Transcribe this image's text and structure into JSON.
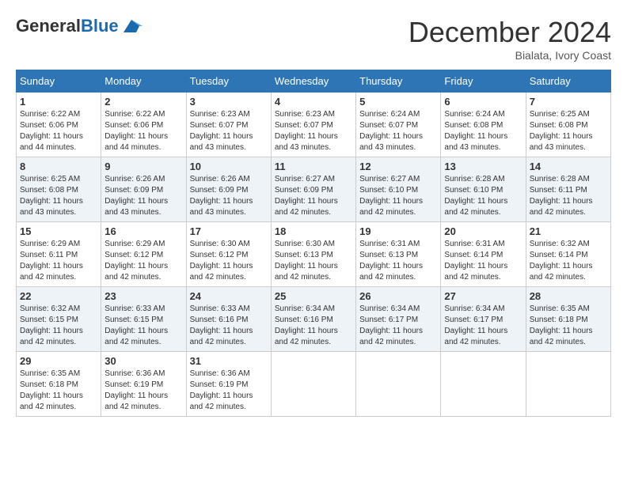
{
  "header": {
    "logo_general": "General",
    "logo_blue": "Blue",
    "month_title": "December 2024",
    "subtitle": "Bialata, Ivory Coast"
  },
  "calendar": {
    "days_of_week": [
      "Sunday",
      "Monday",
      "Tuesday",
      "Wednesday",
      "Thursday",
      "Friday",
      "Saturday"
    ],
    "weeks": [
      [
        {
          "day": "1",
          "sunrise": "6:22 AM",
          "sunset": "6:06 PM",
          "daylight": "11 hours and 44 minutes."
        },
        {
          "day": "2",
          "sunrise": "6:22 AM",
          "sunset": "6:06 PM",
          "daylight": "11 hours and 44 minutes."
        },
        {
          "day": "3",
          "sunrise": "6:23 AM",
          "sunset": "6:07 PM",
          "daylight": "11 hours and 43 minutes."
        },
        {
          "day": "4",
          "sunrise": "6:23 AM",
          "sunset": "6:07 PM",
          "daylight": "11 hours and 43 minutes."
        },
        {
          "day": "5",
          "sunrise": "6:24 AM",
          "sunset": "6:07 PM",
          "daylight": "11 hours and 43 minutes."
        },
        {
          "day": "6",
          "sunrise": "6:24 AM",
          "sunset": "6:08 PM",
          "daylight": "11 hours and 43 minutes."
        },
        {
          "day": "7",
          "sunrise": "6:25 AM",
          "sunset": "6:08 PM",
          "daylight": "11 hours and 43 minutes."
        }
      ],
      [
        {
          "day": "8",
          "sunrise": "6:25 AM",
          "sunset": "6:08 PM",
          "daylight": "11 hours and 43 minutes."
        },
        {
          "day": "9",
          "sunrise": "6:26 AM",
          "sunset": "6:09 PM",
          "daylight": "11 hours and 43 minutes."
        },
        {
          "day": "10",
          "sunrise": "6:26 AM",
          "sunset": "6:09 PM",
          "daylight": "11 hours and 43 minutes."
        },
        {
          "day": "11",
          "sunrise": "6:27 AM",
          "sunset": "6:09 PM",
          "daylight": "11 hours and 42 minutes."
        },
        {
          "day": "12",
          "sunrise": "6:27 AM",
          "sunset": "6:10 PM",
          "daylight": "11 hours and 42 minutes."
        },
        {
          "day": "13",
          "sunrise": "6:28 AM",
          "sunset": "6:10 PM",
          "daylight": "11 hours and 42 minutes."
        },
        {
          "day": "14",
          "sunrise": "6:28 AM",
          "sunset": "6:11 PM",
          "daylight": "11 hours and 42 minutes."
        }
      ],
      [
        {
          "day": "15",
          "sunrise": "6:29 AM",
          "sunset": "6:11 PM",
          "daylight": "11 hours and 42 minutes."
        },
        {
          "day": "16",
          "sunrise": "6:29 AM",
          "sunset": "6:12 PM",
          "daylight": "11 hours and 42 minutes."
        },
        {
          "day": "17",
          "sunrise": "6:30 AM",
          "sunset": "6:12 PM",
          "daylight": "11 hours and 42 minutes."
        },
        {
          "day": "18",
          "sunrise": "6:30 AM",
          "sunset": "6:13 PM",
          "daylight": "11 hours and 42 minutes."
        },
        {
          "day": "19",
          "sunrise": "6:31 AM",
          "sunset": "6:13 PM",
          "daylight": "11 hours and 42 minutes."
        },
        {
          "day": "20",
          "sunrise": "6:31 AM",
          "sunset": "6:14 PM",
          "daylight": "11 hours and 42 minutes."
        },
        {
          "day": "21",
          "sunrise": "6:32 AM",
          "sunset": "6:14 PM",
          "daylight": "11 hours and 42 minutes."
        }
      ],
      [
        {
          "day": "22",
          "sunrise": "6:32 AM",
          "sunset": "6:15 PM",
          "daylight": "11 hours and 42 minutes."
        },
        {
          "day": "23",
          "sunrise": "6:33 AM",
          "sunset": "6:15 PM",
          "daylight": "11 hours and 42 minutes."
        },
        {
          "day": "24",
          "sunrise": "6:33 AM",
          "sunset": "6:16 PM",
          "daylight": "11 hours and 42 minutes."
        },
        {
          "day": "25",
          "sunrise": "6:34 AM",
          "sunset": "6:16 PM",
          "daylight": "11 hours and 42 minutes."
        },
        {
          "day": "26",
          "sunrise": "6:34 AM",
          "sunset": "6:17 PM",
          "daylight": "11 hours and 42 minutes."
        },
        {
          "day": "27",
          "sunrise": "6:34 AM",
          "sunset": "6:17 PM",
          "daylight": "11 hours and 42 minutes."
        },
        {
          "day": "28",
          "sunrise": "6:35 AM",
          "sunset": "6:18 PM",
          "daylight": "11 hours and 42 minutes."
        }
      ],
      [
        {
          "day": "29",
          "sunrise": "6:35 AM",
          "sunset": "6:18 PM",
          "daylight": "11 hours and 42 minutes."
        },
        {
          "day": "30",
          "sunrise": "6:36 AM",
          "sunset": "6:19 PM",
          "daylight": "11 hours and 42 minutes."
        },
        {
          "day": "31",
          "sunrise": "6:36 AM",
          "sunset": "6:19 PM",
          "daylight": "11 hours and 42 minutes."
        },
        null,
        null,
        null,
        null
      ]
    ]
  }
}
